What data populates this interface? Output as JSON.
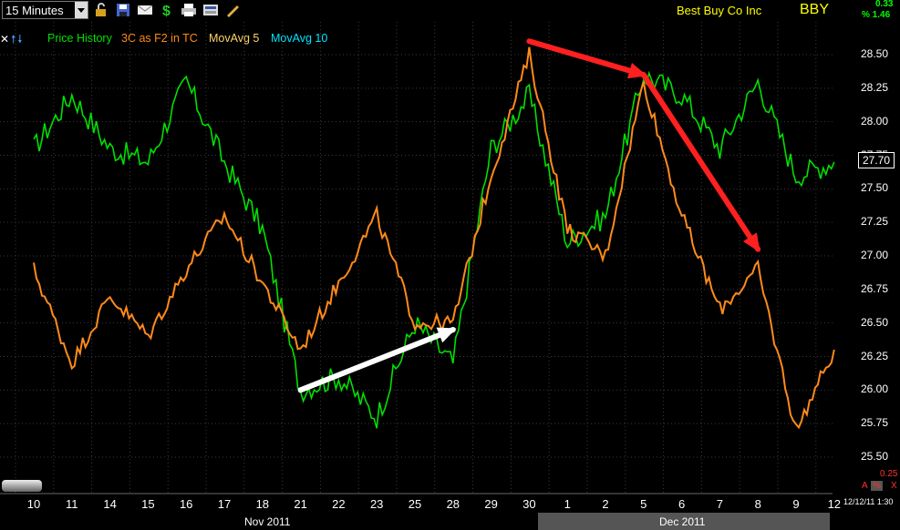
{
  "toolbar": {
    "interval": "15 Minutes",
    "company": "Best Buy Co Inc",
    "ticker": "BBY",
    "change_value": "0.33",
    "change_pct": "% 1.46",
    "icons": [
      "unlock-icon",
      "save-icon",
      "mail-icon",
      "dollar-icon",
      "print-icon",
      "screen-icon",
      "pencil-icon"
    ]
  },
  "legend": {
    "items": [
      {
        "label": "Price History",
        "color": "#00e000"
      },
      {
        "label": "3C as F2 in TC",
        "color": "#ff8a1a"
      },
      {
        "label": "MovAvg 5",
        "color": "#ffd26a"
      },
      {
        "label": "MovAvg 10",
        "color": "#00e5ff"
      }
    ]
  },
  "axis": {
    "y_ticks": [
      "28.50",
      "28.25",
      "28.00",
      "27.75",
      "27.50",
      "27.25",
      "27.00",
      "26.75",
      "26.50",
      "26.25",
      "26.00",
      "25.75",
      "25.50"
    ],
    "last_price": "27.70",
    "lower_value": "0.25",
    "lower_tag": "A",
    "lower_pct": "%",
    "lower_x": "X",
    "timestamp": "12/12/11 1:30"
  },
  "x_axis": {
    "days": [
      "10",
      "11",
      "14",
      "15",
      "16",
      "17",
      "18",
      "21",
      "22",
      "23",
      "25",
      "28",
      "29",
      "30",
      "1",
      "2",
      "5",
      "6",
      "7",
      "8",
      "9",
      "12"
    ],
    "months": [
      "Nov 2011",
      "Dec 2011"
    ]
  },
  "chart_data": {
    "type": "line",
    "title": "",
    "xlabel": "",
    "ylabel": "",
    "ylim": [
      25.5,
      28.6
    ],
    "categories": [
      "10",
      "11",
      "14",
      "15",
      "16",
      "17",
      "18",
      "21",
      "22",
      "23",
      "25",
      "28",
      "29",
      "30",
      "1",
      "2",
      "5",
      "6",
      "7",
      "8",
      "9",
      "12"
    ],
    "series": [
      {
        "name": "Price History",
        "color": "#00e000",
        "values": [
          27.8,
          28.2,
          27.8,
          27.7,
          28.3,
          27.7,
          27.2,
          26.0,
          26.1,
          25.8,
          26.5,
          26.2,
          27.8,
          28.2,
          27.1,
          27.3,
          28.35,
          28.2,
          27.8,
          28.3,
          27.6,
          27.7
        ]
      },
      {
        "name": "3C as F2 in TC",
        "color": "#ff8a1a",
        "values": [
          26.9,
          26.2,
          26.7,
          26.4,
          26.9,
          27.3,
          26.8,
          26.3,
          26.8,
          27.3,
          26.5,
          26.5,
          27.6,
          28.5,
          27.2,
          27.0,
          28.3,
          27.3,
          26.6,
          26.9,
          25.7,
          26.3
        ]
      }
    ],
    "annotations": [
      {
        "type": "arrow",
        "color": "white",
        "from": {
          "x": "21",
          "y": 26.0
        },
        "to": {
          "x": "28",
          "y": 26.45
        }
      },
      {
        "type": "arrow",
        "color": "red",
        "from": {
          "x": "30",
          "y": 28.6
        },
        "to": {
          "x": "5",
          "y": 28.35
        }
      },
      {
        "type": "arrow",
        "color": "red",
        "from": {
          "x": "5",
          "y": 28.35
        },
        "to": {
          "x": "8",
          "y": 27.05
        }
      }
    ]
  },
  "colors": {
    "background": "#000000",
    "grid": "#3a3a3a",
    "price": "#00e000",
    "indicator": "#ff8a1a",
    "ticker_text": "#ffff00",
    "month_bar_dec": "#555555"
  }
}
